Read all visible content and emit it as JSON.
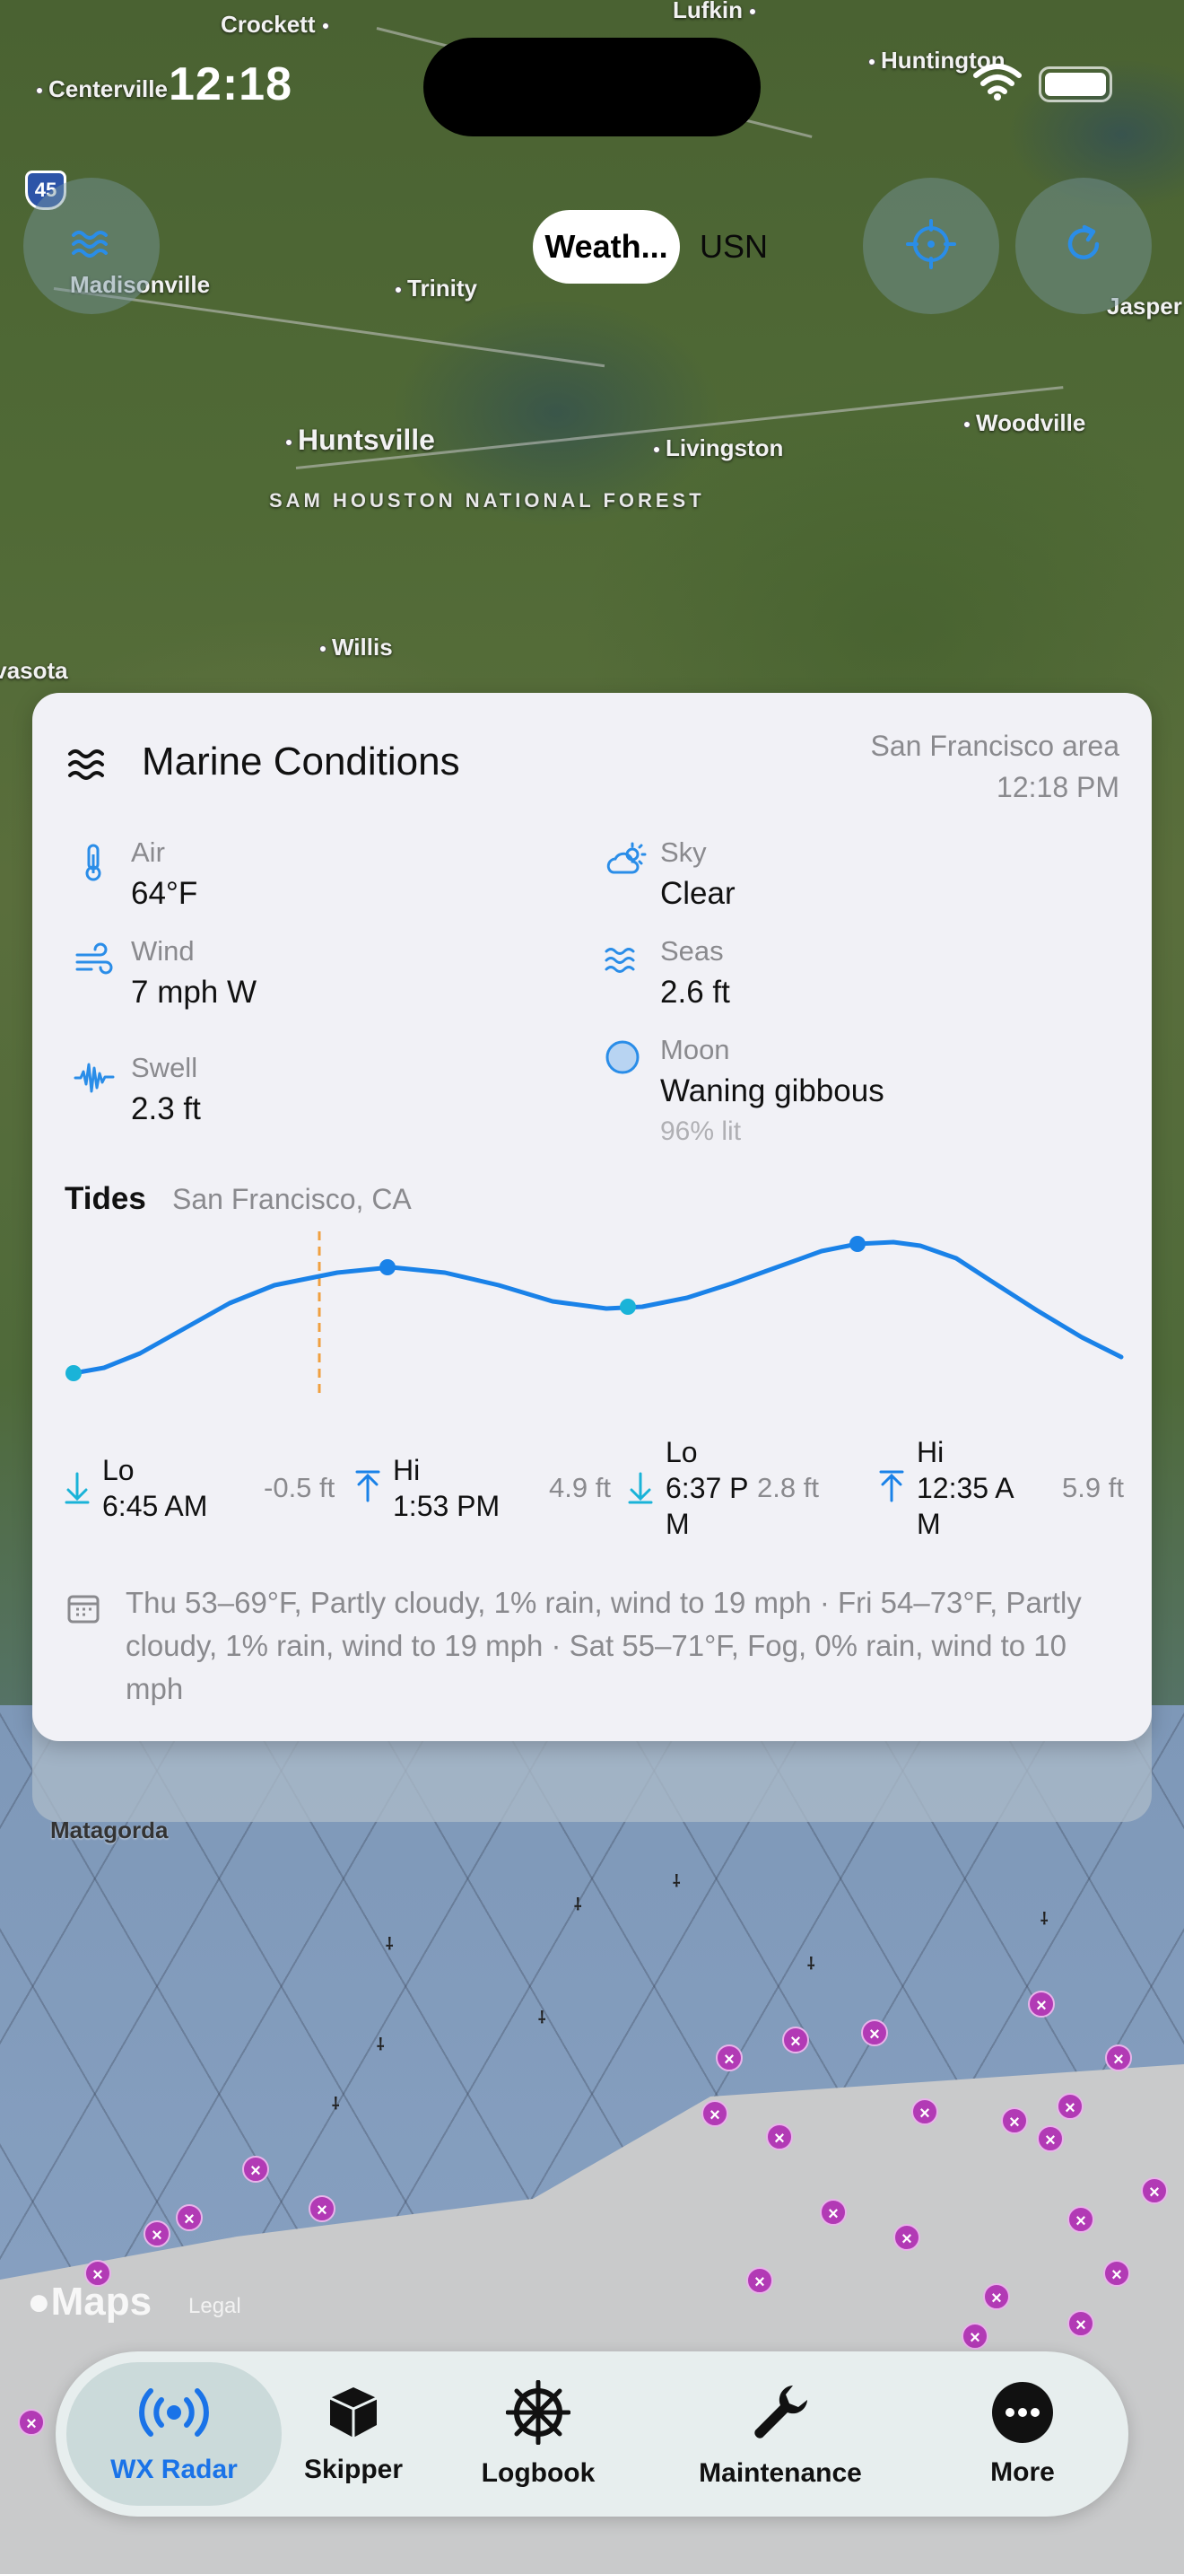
{
  "status_bar": {
    "time": "12:18"
  },
  "map": {
    "places": [
      "Crockett",
      "Lufkin",
      "Centerville",
      "Huntington",
      "Madisonville",
      "Trinity",
      "Jasper",
      "Huntsville",
      "Livingston",
      "Woodville",
      "SAM HOUSTON NATIONAL FOREST",
      "Willis",
      "Navasota",
      "Matagorda"
    ],
    "highway": "45",
    "attribution": {
      "logo": "Maps",
      "legal": "Legal"
    }
  },
  "top_controls": {
    "layers_icon": "waves-icon",
    "segments": [
      "Weath...",
      "USN"
    ],
    "selected_segment": "Weath...",
    "locate_icon": "crosshair-icon",
    "refresh_icon": "refresh-icon"
  },
  "panel": {
    "title": "Marine Conditions",
    "location": "San Francisco area",
    "time": "12:18 PM",
    "conditions": {
      "air": {
        "label": "Air",
        "value": "64°F",
        "icon": "thermometer-icon"
      },
      "sky": {
        "label": "Sky",
        "value": "Clear",
        "icon": "partly-sunny-icon"
      },
      "wind": {
        "label": "Wind",
        "value": "7 mph W",
        "icon": "wind-icon"
      },
      "seas": {
        "label": "Seas",
        "value": "2.6 ft",
        "icon": "waves-icon"
      },
      "swell": {
        "label": "Swell",
        "value": "2.3 ft",
        "icon": "waveform-icon"
      },
      "moon": {
        "label": "Moon",
        "value": "Waning gibbous",
        "sub": "96% lit",
        "icon": "moon-icon"
      }
    },
    "tides": {
      "label": "Tides",
      "location": "San Francisco, CA",
      "events": [
        {
          "kind": "Lo",
          "time": "6:45 AM",
          "height": "-0.5 ft",
          "direction": "down"
        },
        {
          "kind": "Hi",
          "time": "1:53 PM",
          "height": "4.9 ft",
          "direction": "up"
        },
        {
          "kind": "Lo",
          "time": "6:37 P\nM",
          "height": "2.8 ft",
          "direction": "down"
        },
        {
          "kind": "Hi",
          "time": "12:35 A\nM",
          "height": "5.9 ft",
          "direction": "up"
        }
      ],
      "colors": {
        "curve": "#1a82e8",
        "now_line": "#f0a040",
        "low_point": "#1ab3d8"
      }
    },
    "forecast": "Thu 53–69°F, Partly cloudy, 1% rain, wind to 19 mph · Fri 54–73°F, Partly cloudy, 1% rain, wind to 19 mph · Sat 55–71°F, Fog, 0% rain, wind to 10 mph"
  },
  "tab_bar": {
    "tabs": [
      {
        "label": "WX Radar",
        "icon": "radar-icon",
        "active": true
      },
      {
        "label": "Skipper",
        "icon": "cube-icon",
        "active": false
      },
      {
        "label": "Logbook",
        "icon": "helm-wheel-icon",
        "active": false
      },
      {
        "label": "Maintenance",
        "icon": "wrench-icon",
        "active": false
      },
      {
        "label": "More",
        "icon": "ellipsis-icon",
        "active": false
      }
    ],
    "accent": "#1a73e8"
  }
}
